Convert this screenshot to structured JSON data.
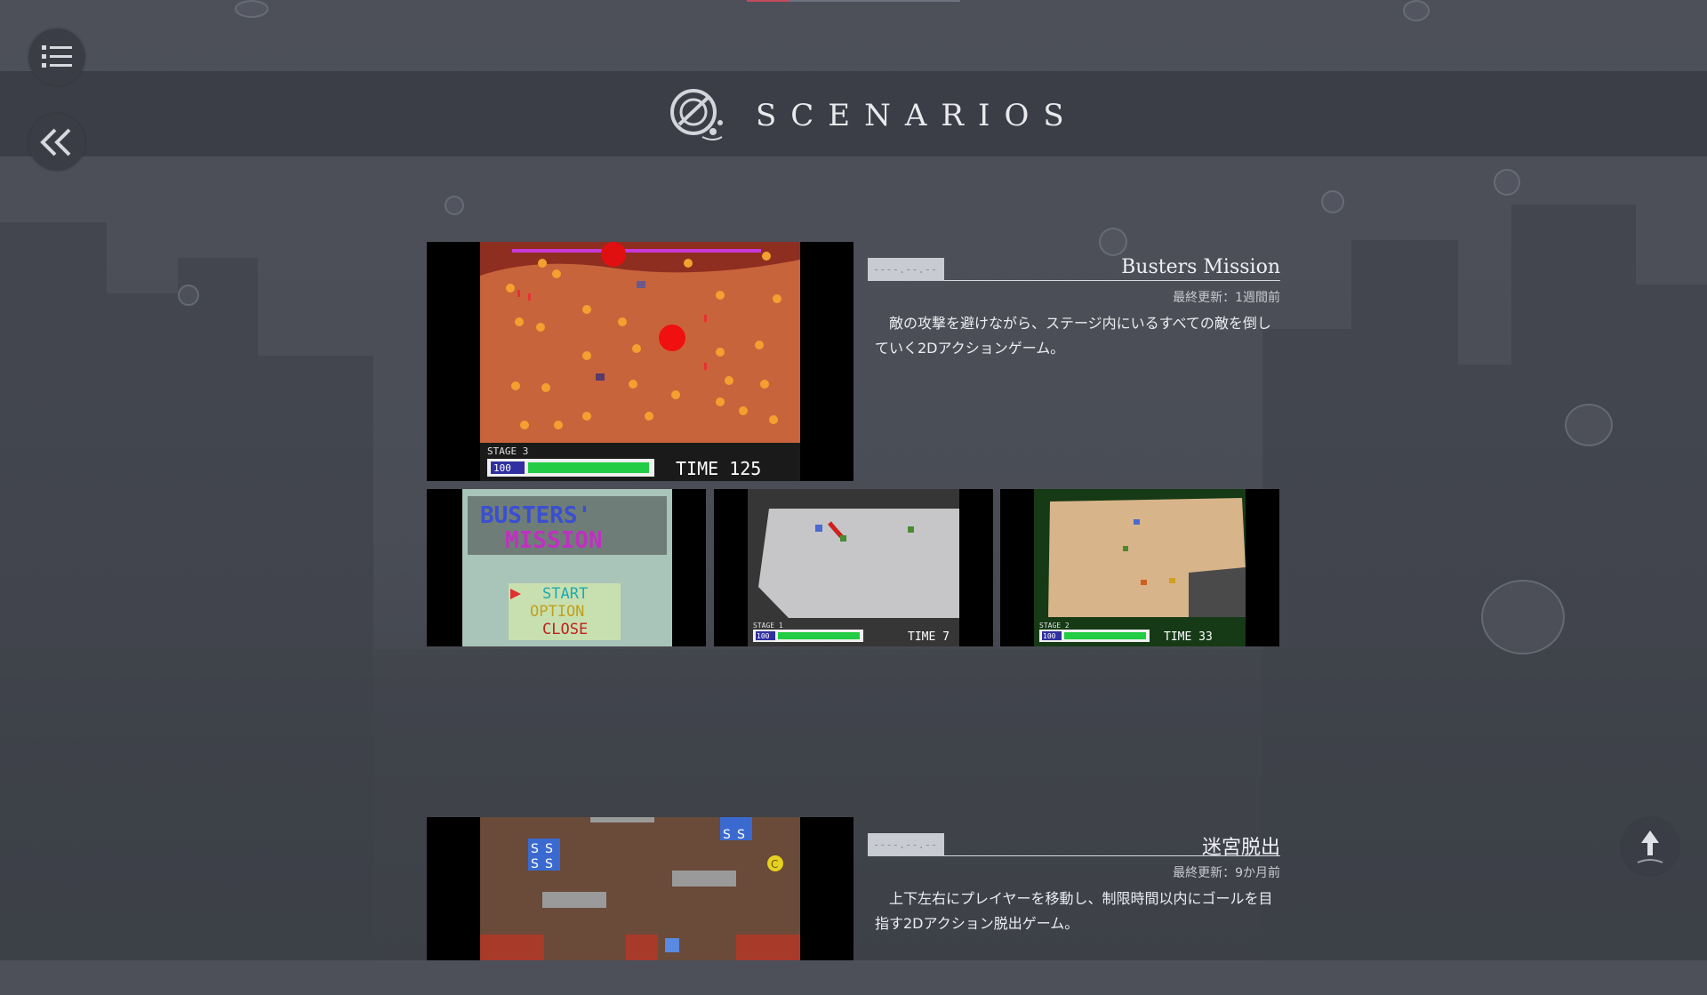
{
  "header": {
    "title": "SCENARIOS"
  },
  "nav": {
    "menu_icon": "list-icon",
    "back_icon": "double-chevron-left-icon",
    "scroll_top_icon": "arrow-up-icon"
  },
  "scenarios": [
    {
      "date": "----.--.--",
      "title": "Busters Mission",
      "updated": "最終更新：1週間前",
      "description": "敵の攻撃を避けながら、ステージ内にいるすべての敵を倒していく2Dアクションゲーム。",
      "main_screenshot": {
        "stage": "STAGE 3",
        "hp": "100",
        "time": "TIME 125"
      },
      "thumbnails": [
        {
          "logo_line1": "BUSTERS'",
          "logo_line2": "MISSION",
          "menu": [
            "START",
            "OPTION",
            "CLOSE"
          ]
        },
        {
          "stage": "STAGE 1",
          "hp": "100",
          "time": "TIME 7"
        },
        {
          "stage": "STAGE 2",
          "hp": "100",
          "time": "TIME 33"
        }
      ]
    },
    {
      "date": "----.--.--",
      "title": "迷宮脱出",
      "updated": "最終更新：9か月前",
      "description": "上下左右にプレイヤーを移動し、制限時間以内にゴールを目指す2Dアクション脱出ゲーム。",
      "main_screenshot": {
        "tile_label": "S",
        "coin_label": "C"
      }
    }
  ],
  "colors": {
    "header_band": "#3b3e46",
    "accent": "#c24a5c",
    "hp_bar": "#22cc44",
    "lava": "#c8643c"
  }
}
